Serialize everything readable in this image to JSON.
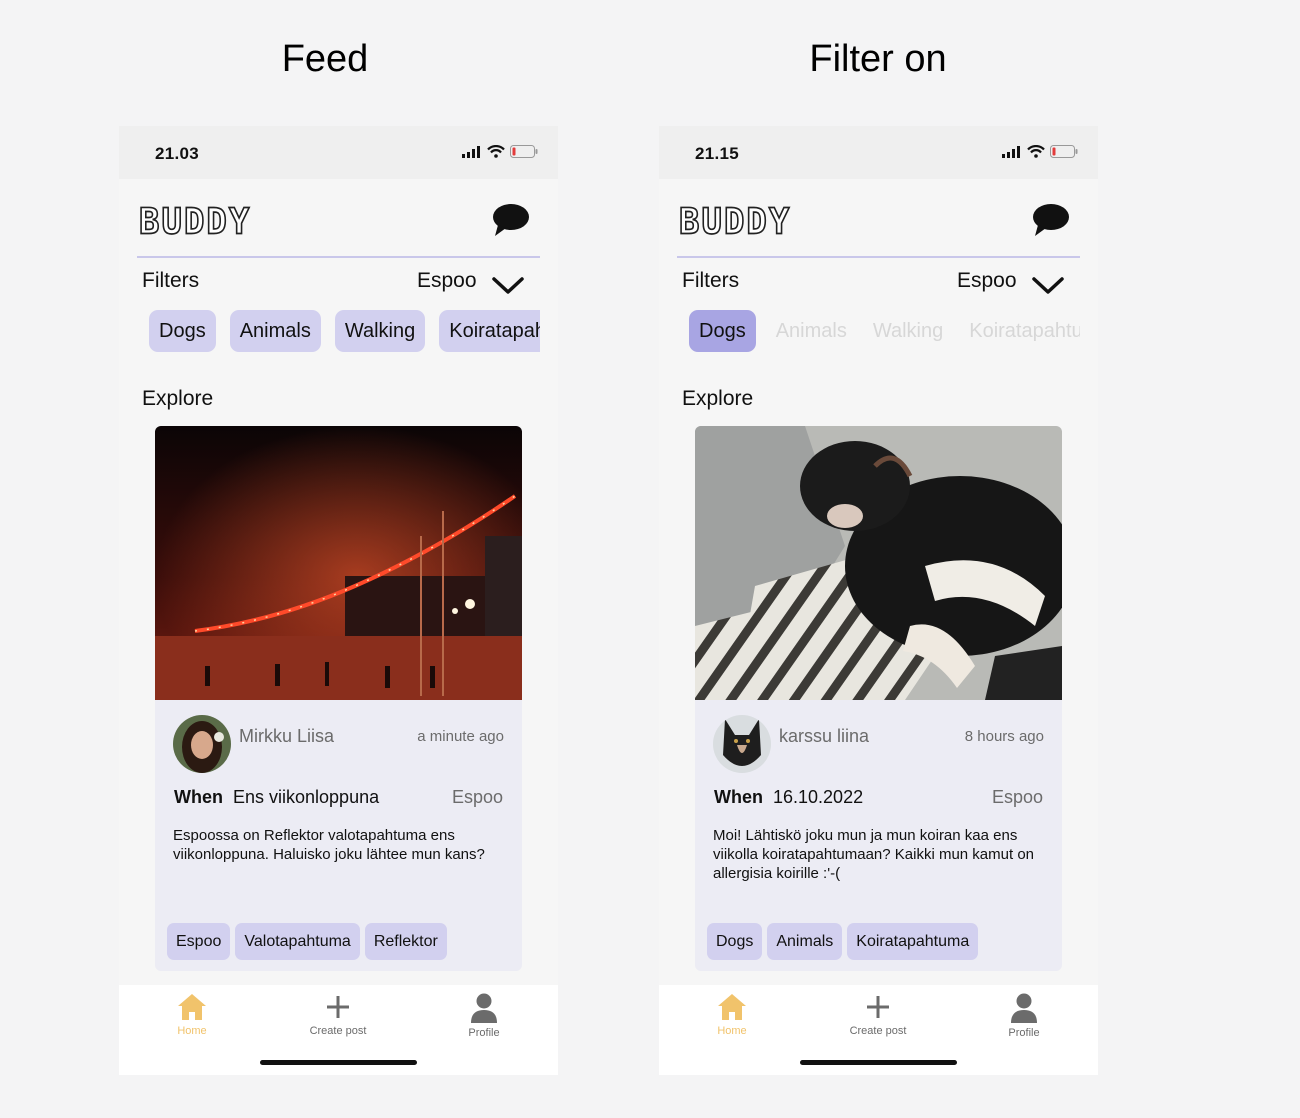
{
  "screens": [
    {
      "title": "Feed",
      "status_time": "21.03",
      "logo": "BUDDY",
      "filters_label": "Filters",
      "location": "Espoo",
      "chips": [
        {
          "label": "Dogs",
          "state": "normal"
        },
        {
          "label": "Animals",
          "state": "normal"
        },
        {
          "label": "Walking",
          "state": "normal"
        },
        {
          "label": "Koiratapah",
          "state": "normal"
        }
      ],
      "explore_label": "Explore",
      "post": {
        "image": "night-street-lights",
        "author": "Mirkku Liisa",
        "time": "a minute ago",
        "when_label": "When",
        "when_value": "Ens viikonloppuna",
        "location": "Espoo",
        "body": "Espoossa on Reflektor valotapahtuma ens viikonloppuna. Haluisko joku lähtee mun kans?",
        "tags": [
          "Espoo",
          "Valotapahtuma",
          "Reflektor"
        ]
      },
      "nav": {
        "home": "Home",
        "create": "Create post",
        "profile": "Profile"
      }
    },
    {
      "title": "Filter on",
      "status_time": "21.15",
      "logo": "BUDDY",
      "filters_label": "Filters",
      "location": "Espoo",
      "chips": [
        {
          "label": "Dogs",
          "state": "active"
        },
        {
          "label": "Animals",
          "state": "faded"
        },
        {
          "label": "Walking",
          "state": "faded"
        },
        {
          "label": "Koiratapahtu",
          "state": "faded"
        }
      ],
      "explore_label": "Explore",
      "post": {
        "image": "dog-on-zebra-blanket",
        "author": "karssu liina",
        "time": "8 hours ago",
        "when_label": "When",
        "when_value": "16.10.2022",
        "location": "Espoo",
        "body": "Moi! Lähtiskö joku mun ja mun koiran kaa ens viikolla koiratapahtumaan? Kaikki mun kamut on allergisia koirille :'-(",
        "tags": [
          "Dogs",
          "Animals",
          "Koiratapahtuma"
        ]
      },
      "nav": {
        "home": "Home",
        "create": "Create post",
        "profile": "Profile"
      }
    }
  ],
  "colors": {
    "chip": "#d2d0ef",
    "chip_active": "#a8a5e3",
    "accent_nav": "#f1c36b",
    "divider": "#c9c7ea",
    "card": "#ececf4"
  }
}
